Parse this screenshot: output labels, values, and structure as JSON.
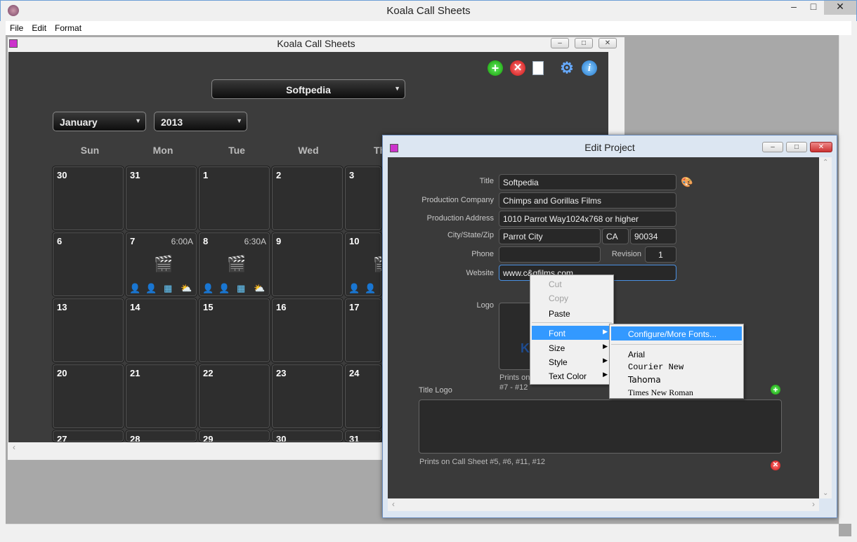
{
  "app": {
    "title": "Koala Call Sheets"
  },
  "menubar": [
    "File",
    "Edit",
    "Format"
  ],
  "calendar_window": {
    "title": "Koala Call Sheets",
    "project_select": "Softpedia",
    "month_select": "January",
    "year_select": "2013",
    "days": [
      "Sun",
      "Mon",
      "Tue",
      "Wed",
      "Th"
    ],
    "weeks": [
      [
        "30",
        "31",
        "1",
        "2",
        "3"
      ],
      [
        "6",
        "7",
        "8",
        "9",
        "10"
      ],
      [
        "13",
        "14",
        "15",
        "16",
        "17"
      ],
      [
        "20",
        "21",
        "22",
        "23",
        "24"
      ],
      [
        "27",
        "28",
        "29",
        "30",
        "31"
      ]
    ],
    "events": {
      "7": "6:00A",
      "8": "6:30A"
    }
  },
  "edit_project": {
    "title": "Edit Project",
    "labels": {
      "title": "Title",
      "company": "Production Company",
      "address": "Production Address",
      "city": "City/State/Zip",
      "phone": "Phone",
      "revision": "Revision",
      "website": "Website",
      "logo": "Logo",
      "title_logo": "Title Logo"
    },
    "values": {
      "title": "Softpedia",
      "company": "Chimps and Gorillas Films",
      "address": "1010 Parrot Way1024x768 or higher",
      "city": "Parrot City",
      "state": "CA",
      "zip": "90034",
      "phone": "",
      "revision": "1",
      "website": "www.c&gfilms.com"
    },
    "logo_note_1": "Prints on",
    "logo_note_2": "#7 - #12",
    "title_logo_note": "Prints on Call Sheet #5, #6, #11, #12"
  },
  "context_menu": {
    "items": [
      "Cut",
      "Copy",
      "Paste",
      "Font",
      "Size",
      "Style",
      "Text Color"
    ]
  },
  "font_submenu": {
    "items": [
      "Configure/More Fonts...",
      "Arial",
      "Courier New",
      "Tahoma",
      "Times New Roman"
    ]
  },
  "colors": {
    "accent": "#3399ff",
    "calendar_bg": "#3c3c3c",
    "cell_bg": "#2e2e2e"
  }
}
